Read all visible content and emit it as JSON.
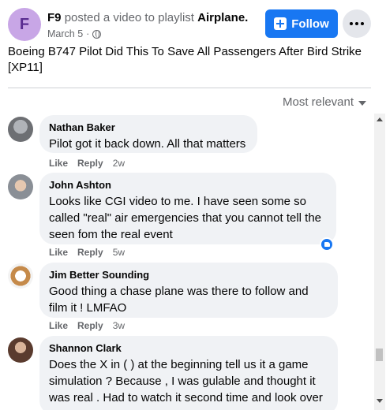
{
  "post": {
    "page_initial": "F",
    "page_name": "F9",
    "action_text": "posted a video to playlist",
    "playlist": "Airplane.",
    "date": "March 5",
    "date_separator": "·",
    "follow_label": "Follow",
    "title": "Boeing B747 Pilot Did This To Save All Passengers After Bird Strike [XP11]"
  },
  "sort": {
    "label": "Most relevant"
  },
  "comments": [
    {
      "name": "Nathan Baker",
      "text": "Pilot got it back down. All that matters",
      "like": "Like",
      "reply": "Reply",
      "time": "2w"
    },
    {
      "name": "John Ashton",
      "text": "Looks like CGI video to me. I have seen some so called \"real\" air emergencies that you cannot tell the seen fom the real event",
      "like": "Like",
      "reply": "Reply",
      "time": "5w"
    },
    {
      "name": "Jim Better Sounding",
      "text": "Good thing a chase plane was there to follow and film it ! LMFAO",
      "like": "Like",
      "reply": "Reply",
      "time": "3w"
    },
    {
      "name": "Shannon Clark",
      "text": "Does the X in ( ) at the beginning tell us it a game simulation ? Because , I was gulable and thought it was real . Had to watch it second time and look over"
    }
  ],
  "colors": {
    "accent": "#1877f2",
    "bubble": "#f0f2f5",
    "secondary_text": "#65676b"
  }
}
